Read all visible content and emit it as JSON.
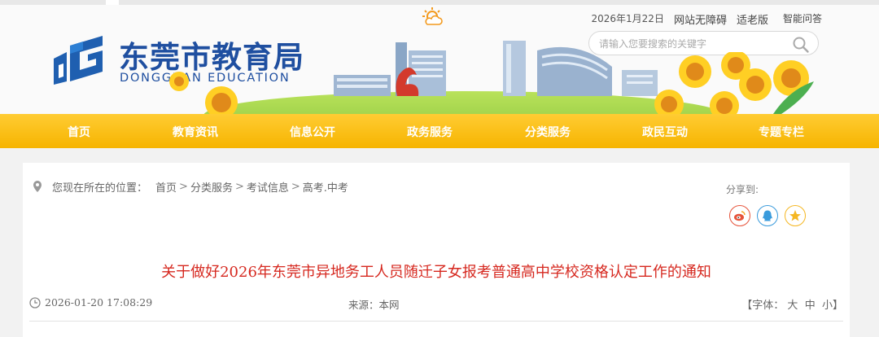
{
  "header": {
    "date": "2026年1月22日",
    "accessibility_link": "网站无障碍",
    "elderly_link": "适老版",
    "smart_qa_link": "智能问答",
    "search": {
      "placeholder": "请输入您要搜索的关键字",
      "value": ""
    },
    "org_name_cn": "东莞市教育局",
    "org_name_en": "DONGGUAN EDUCATION"
  },
  "nav": {
    "items": [
      {
        "label": "首页"
      },
      {
        "label": "教育资讯"
      },
      {
        "label": "信息公开"
      },
      {
        "label": "政务服务"
      },
      {
        "label": "分类服务"
      },
      {
        "label": "政民互动"
      },
      {
        "label": "专题专栏"
      }
    ]
  },
  "breadcrumb": {
    "label": "您现在所在的位置：",
    "items": [
      "首页",
      "分类服务",
      "考试信息",
      "高考.中考"
    ],
    "separator": ">"
  },
  "share": {
    "label": "分享到:",
    "buttons": [
      {
        "icon": "weibo-icon",
        "color": "#e6533a"
      },
      {
        "icon": "qq-icon",
        "color": "#3a9bdc"
      },
      {
        "icon": "qzone-icon",
        "color": "#f5b722"
      }
    ]
  },
  "article": {
    "title": "关于做好2026年东莞市异地务工人员随迁子女报考普通高中学校资格认定工作的通知",
    "datetime": "2026-01-20 17:08:29",
    "source": "来源：本网",
    "font_label": "【字体：",
    "font_large": "大",
    "font_medium": "中",
    "font_small": "小",
    "font_close": "】"
  },
  "colors": {
    "nav_bg": "#f6b400",
    "title_red": "#d6281f",
    "brand_blue": "#1f4fa0"
  }
}
